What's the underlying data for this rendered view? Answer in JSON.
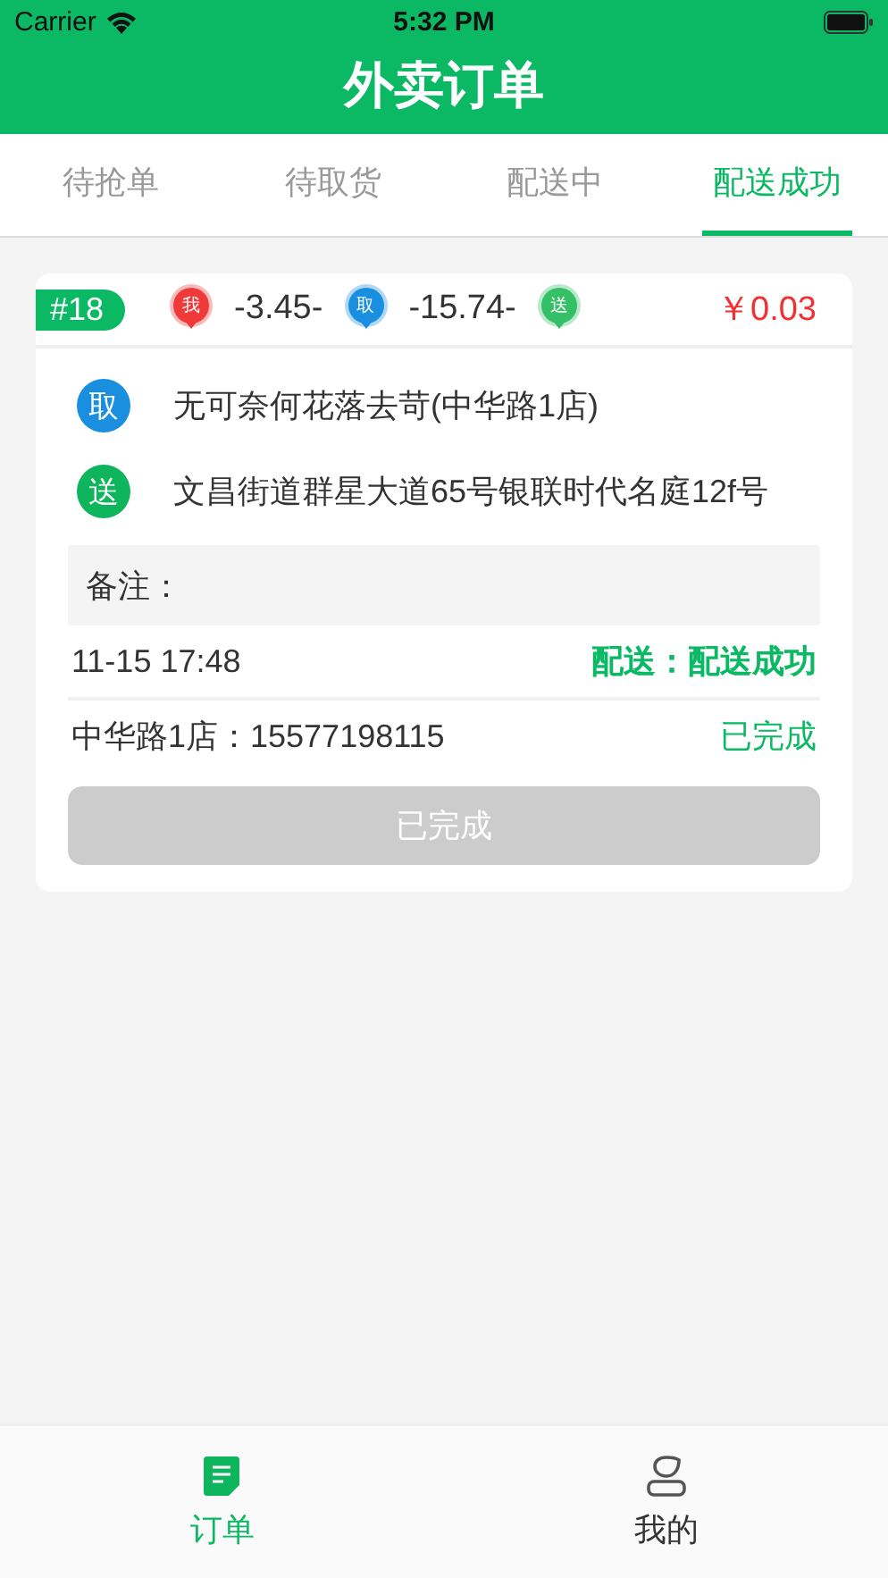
{
  "status_bar": {
    "carrier": "Carrier",
    "time": "5:32 PM"
  },
  "title": "外卖订单",
  "tabs": [
    {
      "label": "待抢单",
      "selected": false
    },
    {
      "label": "待取货",
      "selected": false
    },
    {
      "label": "配送中",
      "selected": false
    },
    {
      "label": "配送成功",
      "selected": true
    }
  ],
  "order": {
    "number": "#18",
    "route": [
      {
        "kind": "pin",
        "label": "我",
        "color": "#f03a3a"
      },
      {
        "kind": "distance",
        "text": "-3.45-"
      },
      {
        "kind": "pin",
        "label": "取",
        "color": "#1a8fe0"
      },
      {
        "kind": "distance",
        "text": "-15.74-"
      },
      {
        "kind": "pin",
        "label": "送",
        "color": "#35c068"
      }
    ],
    "price": "￥0.03",
    "addresses": [
      {
        "badge": "取",
        "color": "#1a8fe0",
        "text": "无可奈何花落去苛(中华路1店)"
      },
      {
        "badge": "送",
        "color": "#0fb55c",
        "text": "文昌街道群星大道65号银联时代名庭12f号"
      }
    ],
    "note": "备注：",
    "time": "11-15 17:48",
    "delivery_status": "配送：配送成功",
    "store": "中华路1店：15577198115",
    "store_status": "已完成",
    "action": {
      "label": "已完成",
      "disabled": true
    }
  },
  "bottom_tabs": [
    {
      "kind": "orders",
      "label": "订单",
      "selected": true
    },
    {
      "kind": "profile",
      "label": "我的",
      "selected": false
    }
  ]
}
